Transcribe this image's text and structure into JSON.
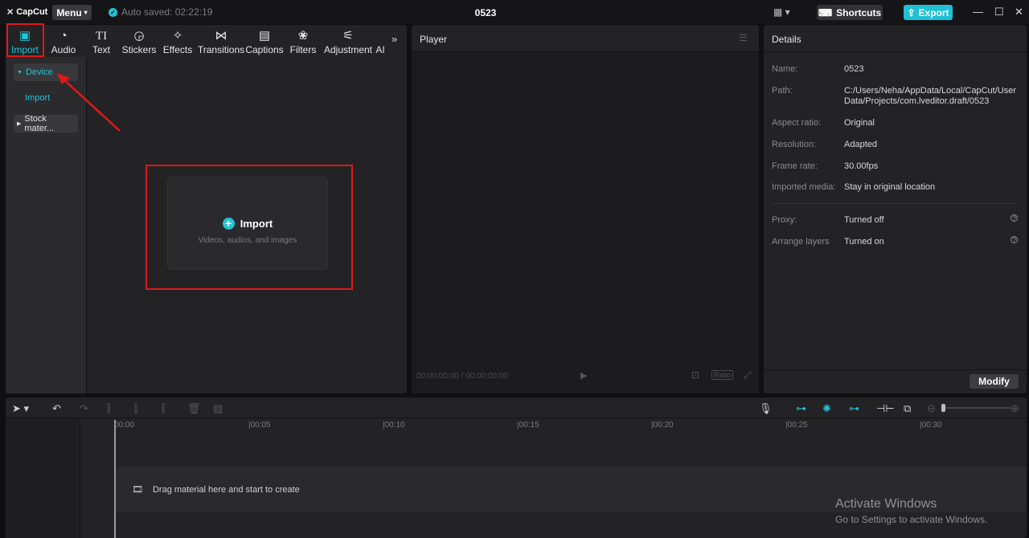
{
  "app": {
    "logo": "CapCut",
    "menu": "Menu",
    "autosave": "Auto saved: 02:22:19",
    "project_title": "0523",
    "shortcuts": "Shortcuts",
    "export": "Export"
  },
  "tabs": [
    {
      "label": "Import",
      "icon": "▣"
    },
    {
      "label": "Audio",
      "icon": "◔"
    },
    {
      "label": "Text",
      "icon": "TI"
    },
    {
      "label": "Stickers",
      "icon": "◶"
    },
    {
      "label": "Effects",
      "icon": "✧"
    },
    {
      "label": "Transitions",
      "icon": "⋈"
    },
    {
      "label": "Captions",
      "icon": "▤"
    },
    {
      "label": "Filters",
      "icon": "❀"
    },
    {
      "label": "Adjustment",
      "icon": "⚟"
    },
    {
      "label": "AI",
      "icon": ""
    }
  ],
  "sidebar": {
    "device": "Device",
    "import": "Import",
    "stock": "Stock mater..."
  },
  "import_card": {
    "label": "Import",
    "sub": "Videos, audios, and images"
  },
  "player": {
    "title": "Player",
    "timecode": "00:00:00:00 / 00:00:00:00",
    "ratio": "Ratio"
  },
  "details": {
    "title": "Details",
    "rows": [
      {
        "label": "Name:",
        "value": "0523"
      },
      {
        "label": "Path:",
        "value": "C:/Users/Neha/AppData/Local/CapCut/User Data/Projects/com.lveditor.draft/0523"
      },
      {
        "label": "Aspect ratio:",
        "value": "Original"
      },
      {
        "label": "Resolution:",
        "value": "Adapted"
      },
      {
        "label": "Frame rate:",
        "value": "30.00fps"
      },
      {
        "label": "Imported media:",
        "value": "Stay in original location"
      },
      {
        "label": "Proxy:",
        "value": "Turned off"
      },
      {
        "label": "Arrange layers",
        "value": "Turned on"
      }
    ],
    "modify": "Modify"
  },
  "timeline": {
    "ruler": [
      "00:00",
      "|00:05",
      "|00:10",
      "|00:15",
      "|00:20",
      "|00:25",
      "|00:30"
    ],
    "track_hint": "Drag material here and start to create"
  },
  "watermark": {
    "line1": "Activate Windows",
    "line2": "Go to Settings to activate Windows."
  },
  "colors": {
    "accent": "#22c3d8",
    "annotation": "#e01818"
  }
}
